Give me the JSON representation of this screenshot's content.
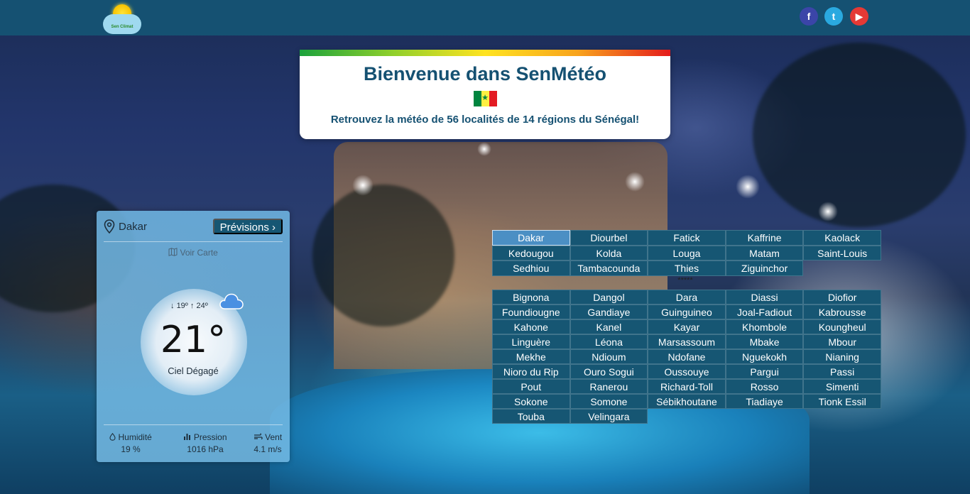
{
  "header": {
    "logo_text": "Sen Climat",
    "social": [
      {
        "name": "facebook",
        "glyph": "f"
      },
      {
        "name": "twitter",
        "glyph": "t"
      },
      {
        "name": "youtube",
        "glyph": "▶"
      }
    ]
  },
  "welcome": {
    "title": "Bienvenue dans SenMétéo",
    "subtitle": "Retrouvez la météo de 56 localités de 14 régions du Sénégal!"
  },
  "weather": {
    "city": "Dakar",
    "forecast_button": "Prévisions",
    "forecast_chevron": "›",
    "map_link": "Voir Carte",
    "min_temp": "19º",
    "max_temp": "24º",
    "temperature": "21°",
    "condition": "Ciel Dégagé",
    "humidity_label": "Humidité",
    "humidity_value": "19 %",
    "pressure_label": "Pression",
    "pressure_value": "1016 hPa",
    "wind_label": "Vent",
    "wind_value": "4.1 m/s",
    "icons": [
      "map-pin-icon",
      "map-icon",
      "arrow-down-icon",
      "arrow-up-icon",
      "cloud-icon",
      "droplet-icon",
      "bar-chart-icon",
      "wind-icon"
    ]
  },
  "regions": [
    "Dakar",
    "Diourbel",
    "Fatick",
    "Kaffrine",
    "Kaolack",
    "Kedougou",
    "Kolda",
    "Louga",
    "Matam",
    "Saint-Louis",
    "Sedhiou",
    "Tambacounda",
    "Thies",
    "Ziguinchor"
  ],
  "selected_region": "Dakar",
  "separator": "*****",
  "localities": [
    "Bignona",
    "Dangol",
    "Dara",
    "Diassi",
    "Diofior",
    "Foundiougne",
    "Gandiaye",
    "Guinguineo",
    "Joal-Fadiout",
    "Kabrousse",
    "Kahone",
    "Kanel",
    "Kayar",
    "Khombole",
    "Koungheul",
    "Linguère",
    "Léona",
    "Marsassoum",
    "Mbake",
    "Mbour",
    "Mekhe",
    "Ndioum",
    "Ndofane",
    "Nguekokh",
    "Nianing",
    "Nioro du Rip",
    "Ouro Sogui",
    "Oussouye",
    "Pargui",
    "Passi",
    "Pout",
    "Ranerou",
    "Richard-Toll",
    "Rosso",
    "Simenti",
    "Sokone",
    "Somone",
    "Sébikhoutane",
    "Tiadiaye",
    "Tionk Essil",
    "Touba",
    "Velingara"
  ]
}
